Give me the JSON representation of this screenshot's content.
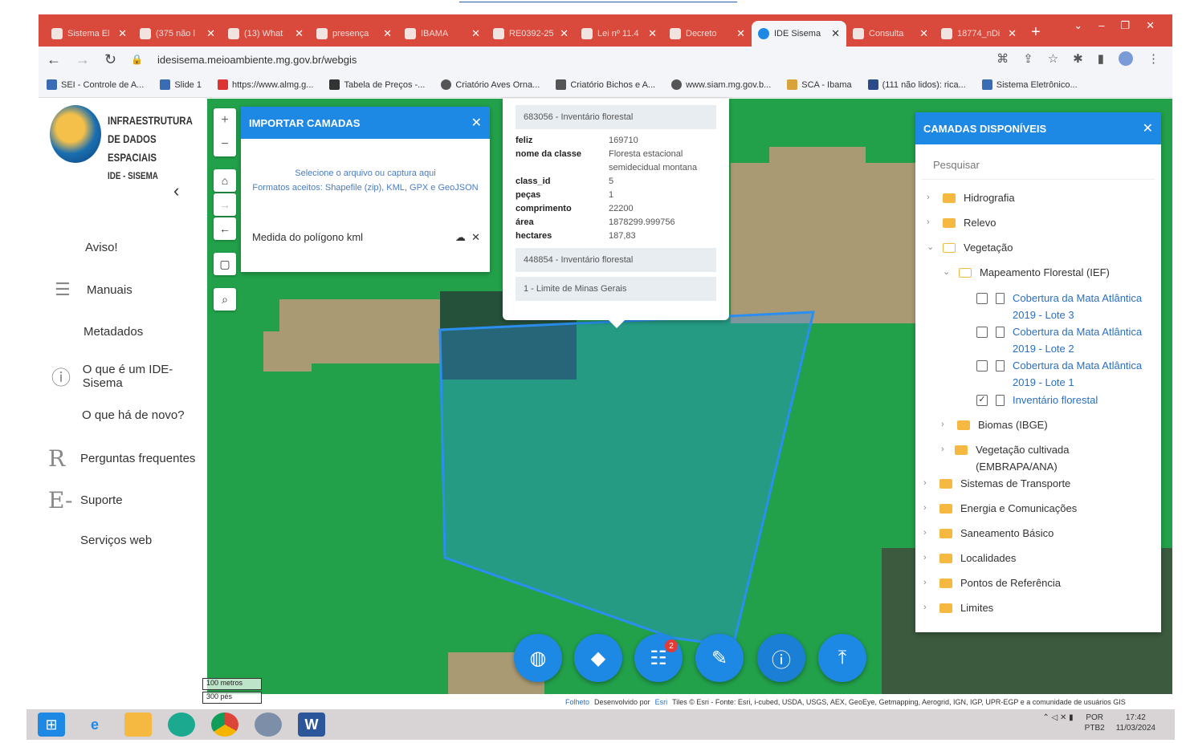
{
  "browser": {
    "tabs": [
      {
        "label": "Sistema El"
      },
      {
        "label": "(375 não l"
      },
      {
        "label": "(13) What"
      },
      {
        "label": "presença"
      },
      {
        "label": "IBAMA"
      },
      {
        "label": "RE0392-25"
      },
      {
        "label": "Lei nº 11.4"
      },
      {
        "label": "Decreto"
      },
      {
        "label": "IDE Sisema"
      },
      {
        "label": "Consulta"
      },
      {
        "label": "18774_nDi"
      }
    ],
    "url": "idesisema.meioambiente.mg.gov.br/webgis",
    "bookmarks": [
      "SEI - Controle de A...",
      "Slide 1",
      "https://www.almg.g...",
      "Tabela de Preços -...",
      "Criatório Aves Orna...",
      "Criatório Bichos e A...",
      "www.siam.mg.gov.b...",
      "SCA - Ibama",
      "(111 não lidos): rica...",
      "Sistema Eletrônico..."
    ]
  },
  "sidebar": {
    "logo_lines": [
      "INFRAESTRUTURA",
      "DE DADOS ESPACIAIS",
      "IDE - SISEMA"
    ],
    "items": [
      {
        "label": "Aviso!"
      },
      {
        "label": "Manuais"
      },
      {
        "label": "Metadados"
      },
      {
        "label": "O que é um IDE-Sisema"
      },
      {
        "label": "O que há de novo?"
      },
      {
        "label": "Perguntas frequentes"
      },
      {
        "label": "Suporte"
      },
      {
        "label": "Serviços web"
      }
    ]
  },
  "import_panel": {
    "title": "IMPORTAR CAMADAS",
    "hint_line1": "Selecione o arquivo ou captura aqui",
    "hint_line2": "Formatos aceitos: Shapefile (zip), KML, GPX e GeoJSON",
    "file_name": "Medida do polígono kml"
  },
  "popup": {
    "header": "683056 - Inventário florestal",
    "attributes": [
      {
        "key": "feliz",
        "value": "169710"
      },
      {
        "key": "nome da classe",
        "value": "Floresta estacional semidecidual montana"
      },
      {
        "key": "class_id",
        "value": "5"
      },
      {
        "key": "peças",
        "value": "1"
      },
      {
        "key": "comprimento",
        "value": "22200"
      },
      {
        "key": "área",
        "value": "1878299.999756"
      },
      {
        "key": "hectares",
        "value": "187,83"
      }
    ],
    "section2": "448854 - Inventário florestal",
    "section3": "1 - Limite de Minas Gerais"
  },
  "layers_panel": {
    "title": "CAMADAS DISPONÍVEIS",
    "search_placeholder": "Pesquisar",
    "items": [
      {
        "label": "Hidrografia"
      },
      {
        "label": "Relevo"
      },
      {
        "label": "Vegetação"
      },
      {
        "label": "Mapeamento Florestal (IEF)"
      },
      {
        "label": "Cobertura da Mata Atlântica 2019 - Lote 3",
        "checked": false
      },
      {
        "label": "Cobertura da Mata Atlântica 2019 - Lote 2",
        "checked": false
      },
      {
        "label": "Cobertura da Mata Atlântica 2019 - Lote 1",
        "checked": false
      },
      {
        "label": "Inventário florestal",
        "checked": true
      },
      {
        "label": "Biomas (IBGE)"
      },
      {
        "label": "Vegetação cultivada (EMBRAPA/ANA)"
      },
      {
        "label": "Sistemas de Transporte"
      },
      {
        "label": "Energia e Comunicações"
      },
      {
        "label": "Saneamento Básico"
      },
      {
        "label": "Localidades"
      },
      {
        "label": "Pontos de Referência"
      },
      {
        "label": "Limites"
      }
    ]
  },
  "map": {
    "badge_count": "2",
    "scale_metric": "100 metros",
    "scale_imperial": "300 pés",
    "attribution_folheto": "Folheto",
    "attribution_dev": "Desenvolvido por",
    "attribution_esri": "Esri",
    "attribution_text": "Tiles © Esri - Fonte: Esri, i-cubed, USDA, USGS, AEX, GeoEye, Getmapping, Aerogrid, IGN, IGP, UPR-EGP e a comunidade de usuários GIS"
  },
  "taskbar": {
    "lang_line1": "POR",
    "lang_line2": "PTB2",
    "time": "17:42",
    "date": "11/03/2024"
  },
  "colors": {
    "accent": "#1e88e5",
    "chrome_tabbar": "#d94a3c",
    "map_green": "#22a14a",
    "polygon_stroke": "#2a8ff0"
  }
}
